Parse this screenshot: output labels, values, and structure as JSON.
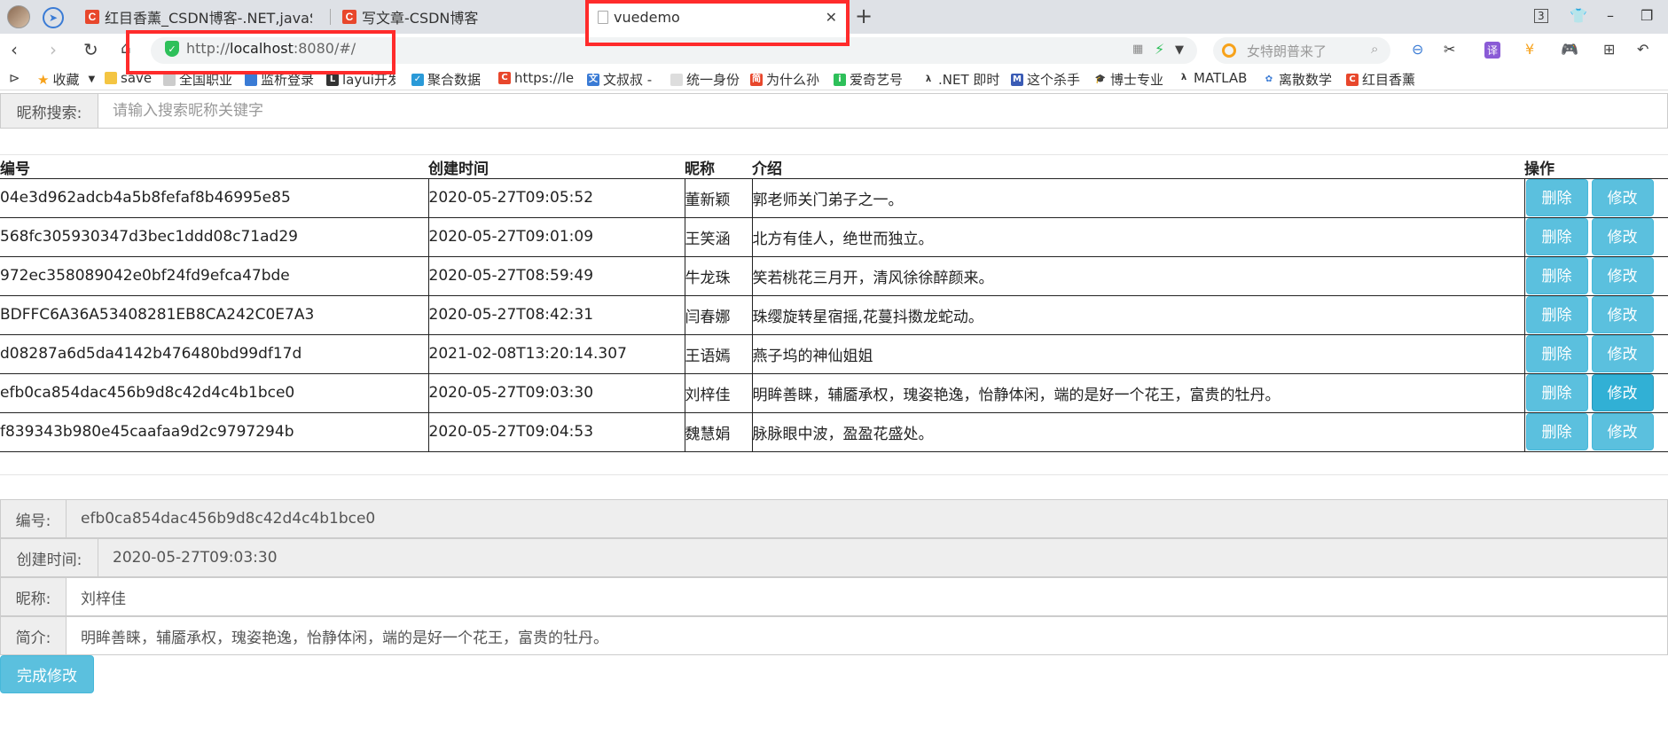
{
  "browser": {
    "tabs": [
      {
        "title": "红目香薰_CSDN博客-.NET,javaSE",
        "favicon": "C"
      },
      {
        "title": "写文章-CSDN博客",
        "favicon": "C"
      },
      {
        "title": "vuedemo",
        "favicon": ""
      }
    ],
    "window_badge": "3",
    "address_prefix": "http://",
    "address_host": "localhost",
    "address_rest": ":8080/#/",
    "search_placeholder": "女特朗普来了",
    "bookmarks": [
      "收藏",
      "save",
      "全国职业",
      "监析登录",
      "layui开发",
      "聚合数据",
      "https://le",
      "文叔叔 -",
      "统一身份",
      "为什么孙",
      "爱奇艺号",
      ".NET 即时",
      "这个杀手",
      "博士专业",
      "MATLAB",
      "离散数学",
      "红目香薰"
    ]
  },
  "search": {
    "label": "昵称搜索:",
    "placeholder": "请输入搜索昵称关键字"
  },
  "table": {
    "headers": {
      "id": "编号",
      "created": "创建时间",
      "nick": "昵称",
      "intro": "介绍",
      "ops": "操作"
    },
    "delete_label": "删除",
    "edit_label": "修改",
    "rows": [
      {
        "id": "04e3d962adcb4a5b8fefaf8b46995e85",
        "created": "2020-05-27T09:05:52",
        "nick": "董新颖",
        "intro": "郭老师关门弟子之一。"
      },
      {
        "id": "568fc305930347d3bec1ddd08c71ad29",
        "created": "2020-05-27T09:01:09",
        "nick": "王笑涵",
        "intro": "北方有佳人，绝世而独立。"
      },
      {
        "id": "972ec358089042e0bf24fd9efca47bde",
        "created": "2020-05-27T08:59:49",
        "nick": "牛龙珠",
        "intro": "笑若桃花三月开，清风徐徐醉颜来。"
      },
      {
        "id": "BDFFC6A36A53408281EB8CA242C0E7A3",
        "created": "2020-05-27T08:42:31",
        "nick": "闫春娜",
        "intro": "珠缨旋转星宿摇,花蔓抖擞龙蛇动。"
      },
      {
        "id": "d08287a6d5da4142b476480bd99df17d",
        "created": "2021-02-08T13:20:14.307",
        "nick": "王语嫣",
        "intro": "燕子坞的神仙姐姐"
      },
      {
        "id": "efb0ca854dac456b9d8c42d4c4b1bce0",
        "created": "2020-05-27T09:03:30",
        "nick": "刘梓佳",
        "intro": "明眸善睐，辅靥承权，瑰姿艳逸，怡静体闲，端的是好一个花王，富贵的牡丹。"
      },
      {
        "id": "f839343b980e45caafaa9d2c9797294b",
        "created": "2020-05-27T09:04:53",
        "nick": "魏慧娟",
        "intro": "脉脉眼中波，盈盈花盛处。"
      }
    ]
  },
  "form": {
    "id_label": "编号:",
    "id_value": "efb0ca854dac456b9d8c42d4c4b1bce0",
    "created_label": "创建时间:",
    "created_value": "2020-05-27T09:03:30",
    "nick_label": "昵称:",
    "nick_value": "刘梓佳",
    "intro_label": "简介:",
    "intro_value": "明眸善睐，辅靥承权，瑰姿艳逸，怡静体闲，端的是好一个花王，富贵的牡丹。",
    "submit_label": "完成修改"
  },
  "colors": {
    "accent": "#5bc0de",
    "highlight": "#ff2b2b"
  }
}
